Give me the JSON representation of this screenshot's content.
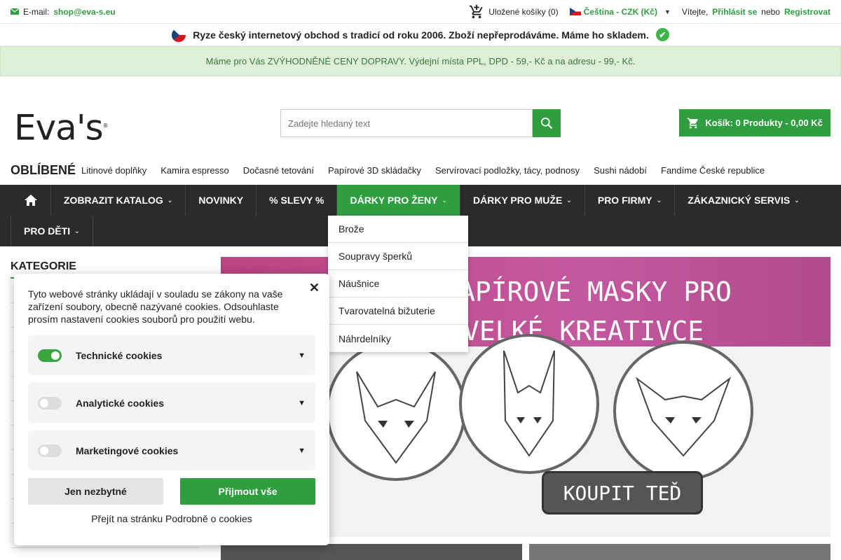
{
  "topbar": {
    "email_label": "E-mail:",
    "email": "shop@eva-s.eu",
    "saved_carts": "Uložené košíky (0)",
    "language": "Čeština - CZK (Kč)",
    "greeting": "Vítejte,",
    "login": "Přihlásit se",
    "or": "nebo",
    "register": "Registrovat"
  },
  "notice": "Ryze český internetový obchod s tradicí od roku 2006. Zboží nepřeprodáváme. Máme ho skladem.",
  "shipping": "Máme pro Vás ZVÝHODNĚNÉ CENY DOPRAVY. Výdejní místa PPL, DPD - 59,- Kč a na adresu - 99,- Kč.",
  "header": {
    "logo": "Eva's",
    "logo_mark": "®",
    "search_placeholder": "Zadejte hledaný text",
    "cart": "Košík: 0 Produkty - 0,00 Kč"
  },
  "favourites": {
    "title": "OBLÍBENÉ",
    "items": [
      "Litinové doplňky",
      "Kamira espresso",
      "Dočasné tetování",
      "Papírové 3D skládačky",
      "Servírovací podložky, tácy, podnosy",
      "Sushi nádobí",
      "Fandíme České republice"
    ]
  },
  "nav": {
    "items": [
      "ZOBRAZIT KATALOG",
      "NOVINKY",
      "% SLEVY %",
      "DÁRKY PRO ŽENY",
      "DÁRKY PRO MUŽE",
      "PRO FIRMY",
      "ZÁKAZNICKÝ SERVIS"
    ],
    "row2": [
      "PRO DĚTI"
    ]
  },
  "dropdown": [
    "Brože",
    "Soupravy šperků",
    "Náušnice",
    "Tvarovatelná bižuterie",
    "Náhrdelníky"
  ],
  "sidebar": {
    "title": "KATEGORIE"
  },
  "banner": {
    "line1": "APÍROVÉ MASKY PRO",
    "line2": "VELKÉ KREATIVCE",
    "button": "KOUPIT TEĎ"
  },
  "cookie": {
    "message": "Tyto webové stránky ukládají v souladu se zákony na vaše zařízení soubory, obecně nazývané cookies. Odsouhlaste prosím nastavení cookies souborů pro použití webu.",
    "categories": [
      {
        "label": "Technické cookies",
        "enabled": true
      },
      {
        "label": "Analytické cookies",
        "enabled": false
      },
      {
        "label": "Marketingové cookies",
        "enabled": false
      }
    ],
    "btn_necessary": "Jen nezbytné",
    "btn_accept": "Přijmout vše",
    "detail_link": "Přejít na stránku Podrobně o cookies"
  },
  "colors": {
    "brand_green": "#2e9e3f",
    "nav_bg": "#2b2b2b"
  }
}
